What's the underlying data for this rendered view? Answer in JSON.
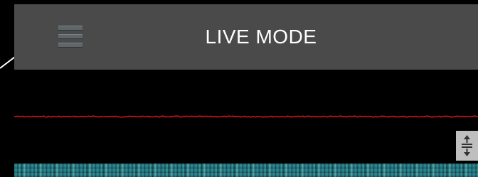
{
  "toolbar": {
    "title": "LIVE MODE",
    "menu_icon": "hamburger-menu-icon",
    "background_color": "#4a4a4a"
  },
  "signal": {
    "color": "#d01414"
  },
  "controls": {
    "scale_icon": "vertical-scale-icon"
  },
  "waterfall": {
    "palette": [
      "#1f6a74",
      "#2a8a8f",
      "#5cb7b0",
      "#123f4c"
    ]
  }
}
